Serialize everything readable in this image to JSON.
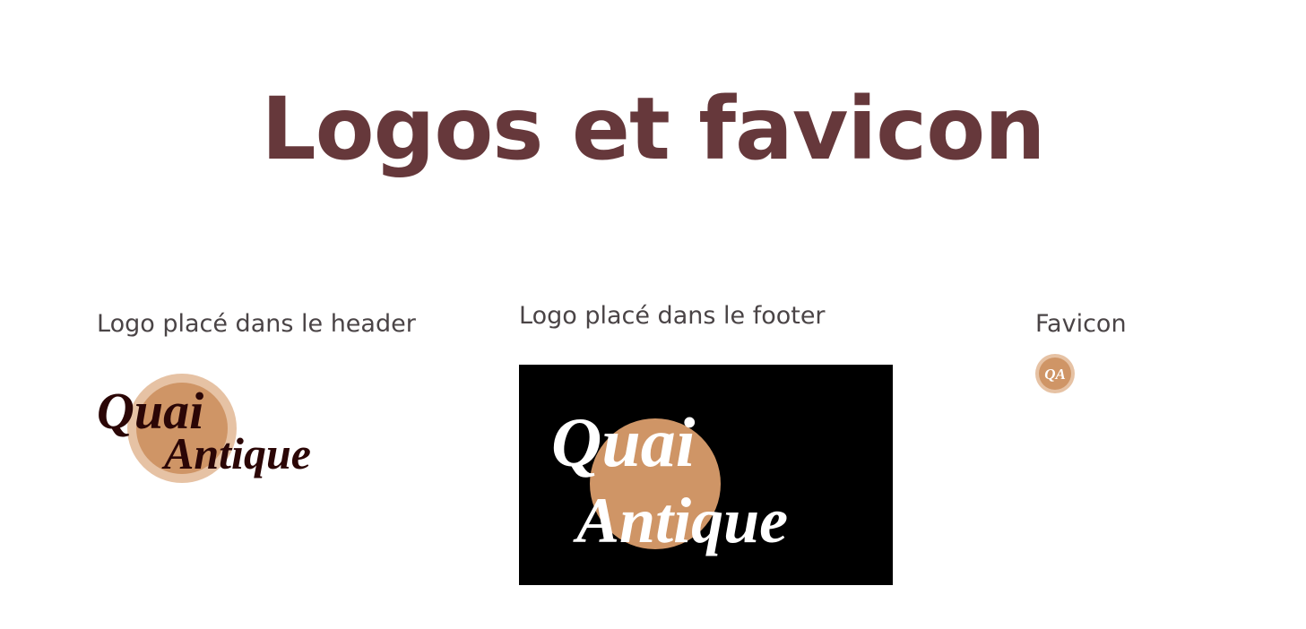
{
  "page": {
    "title": "Logos et favicon"
  },
  "sections": {
    "header_logo": {
      "label": "Logo placé dans le header"
    },
    "footer_logo": {
      "label": "Logo placé dans le footer"
    },
    "favicon": {
      "label": "Favicon"
    }
  },
  "logo": {
    "line1": "Quai",
    "line2": "Antique",
    "monogram": "QA"
  },
  "colors": {
    "title": "#66383b",
    "circle_main": "#cf9566",
    "circle_ring": "#e6c2a4",
    "header_text": "#2b0606",
    "footer_bg": "#000000",
    "footer_text": "#ffffff"
  }
}
